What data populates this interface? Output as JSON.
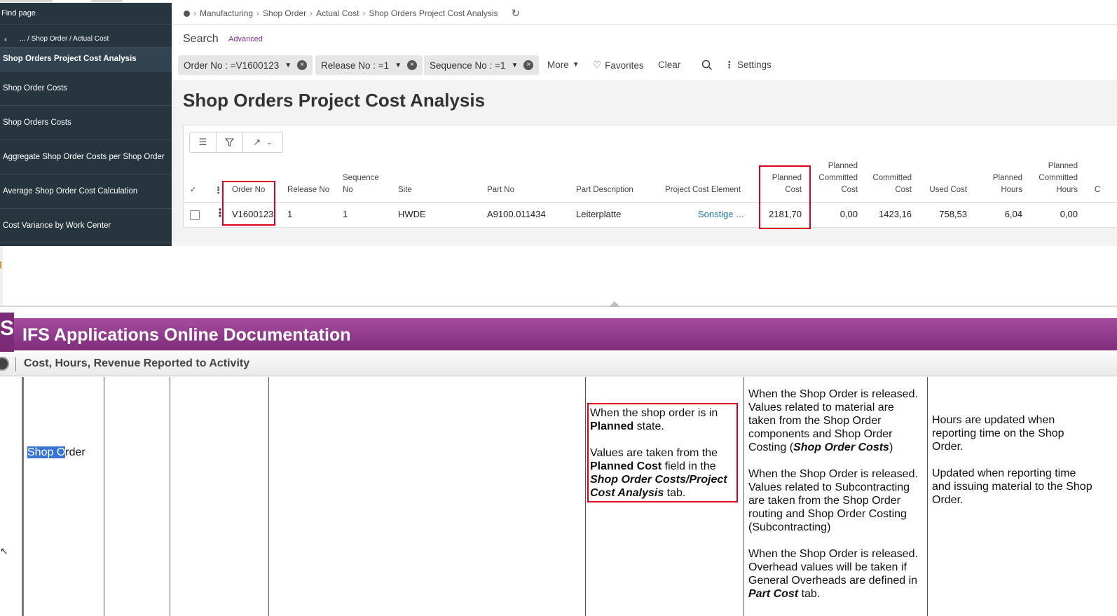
{
  "sidebar": {
    "find_page": "Find page",
    "breadcrumb": "... / Shop Order / Actual Cost",
    "current": "Shop Orders Project Cost Analysis",
    "items": [
      {
        "label": "Shop Order Costs"
      },
      {
        "label": "Shop Orders Costs"
      },
      {
        "label": "Aggregate Shop Order Costs per Shop Order"
      },
      {
        "label": "Average Shop Order Cost Calculation"
      },
      {
        "label": "Cost Variance by Work Center"
      }
    ]
  },
  "breadcrumb": {
    "items": [
      "Manufacturing",
      "Shop Order",
      "Actual Cost",
      "Shop Orders Project Cost Analysis"
    ]
  },
  "search": {
    "label": "Search",
    "advanced": "Advanced",
    "chips": [
      {
        "label": "Order No : =V1600123"
      },
      {
        "label": "Release No : =1"
      },
      {
        "label": "Sequence No : =1"
      }
    ],
    "more": "More",
    "favorites": "Favorites",
    "clear": "Clear",
    "settings": "Settings"
  },
  "page": {
    "title": "Shop Orders Project Cost Analysis"
  },
  "grid": {
    "headers": {
      "order_no": "Order No",
      "release_no": "Release No",
      "sequence_no_1": "Sequence",
      "sequence_no_2": "No",
      "site": "Site",
      "part_no": "Part No",
      "part_description": "Part Description",
      "project_cost_element": "Project Cost Element",
      "planned_cost_1": "Planned",
      "planned_cost_2": "Cost",
      "planned_committed_cost_1": "Planned",
      "planned_committed_cost_2": "Committed",
      "planned_committed_cost_3": "Cost",
      "committed_cost_1": "Committed",
      "committed_cost_2": "Cost",
      "used_cost": "Used Cost",
      "planned_hours_1": "Planned",
      "planned_hours_2": "Hours",
      "planned_committed_hours_1": "Planned",
      "planned_committed_hours_2": "Committed",
      "planned_committed_hours_3": "Hours",
      "cut": "C"
    },
    "row": {
      "order_no": "V1600123",
      "release_no": "1",
      "sequence_no": "1",
      "site": "HWDE",
      "part_no": "A9100.011434",
      "part_description": "Leiterplatte",
      "project_cost_element": "Sonstige ...",
      "planned_cost": "2181,70",
      "planned_committed_cost": "0,00",
      "committed_cost": "1423,16",
      "used_cost": "758,53",
      "planned_hours": "6,04",
      "planned_committed_hours": "0,00"
    }
  },
  "doc": {
    "banner_title": "IFS Applications Online Documentation",
    "logo_glyph": "S",
    "subtitle": "Cost, Hours, Revenue Reported to Activity",
    "row_label_hl": "Shop O",
    "row_label_rest": "rder",
    "planned": {
      "l1": "When the shop order is in",
      "l2_b": "Planned",
      "l2_r": " state.",
      "l3": "Values are taken from the",
      "l4_b": "Planned Cost",
      "l4_r": " field in the",
      "l5_bi": "Shop Order Costs/Project",
      "l6_bi": "Cost Analysis",
      "l6_r": " tab."
    },
    "released": {
      "p1_l1": "When the Shop Order is released.",
      "p1_l2": "Values related to material are",
      "p1_l3": "taken from the Shop Order",
      "p1_l4": "components and Shop Order",
      "p1_l5_r": "Costing (",
      "p1_l5_bi": "Shop Order Costs",
      "p1_l5_end": ")",
      "p2_l1": "When the Shop Order is released.",
      "p2_l2": "Values related to Subcontracting",
      "p2_l3": "are taken from the Shop Order",
      "p2_l4": "routing and Shop Order Costing",
      "p2_l5": "(Subcontracting)",
      "p3_l1": "When the Shop Order is released.",
      "p3_l2": "Overhead values will be taken if",
      "p3_l3": "General Overheads are defined in",
      "p3_l4_bi": "Part Cost",
      "p3_l4_r": " tab."
    },
    "hours": {
      "p1_l1": "Hours are updated when",
      "p1_l2": "reporting time on the Shop",
      "p1_l3": "Order.",
      "p2_l1": "Updated when reporting time",
      "p2_l2": "and issuing material to the Shop",
      "p2_l3": "Order."
    }
  },
  "colors": {
    "sidebar_bg": "#27353f",
    "accent_purple": "#8a2d91",
    "highlight_red": "#e0001b",
    "link_blue": "#1f6fb8",
    "selection_blue": "#3875d7"
  }
}
